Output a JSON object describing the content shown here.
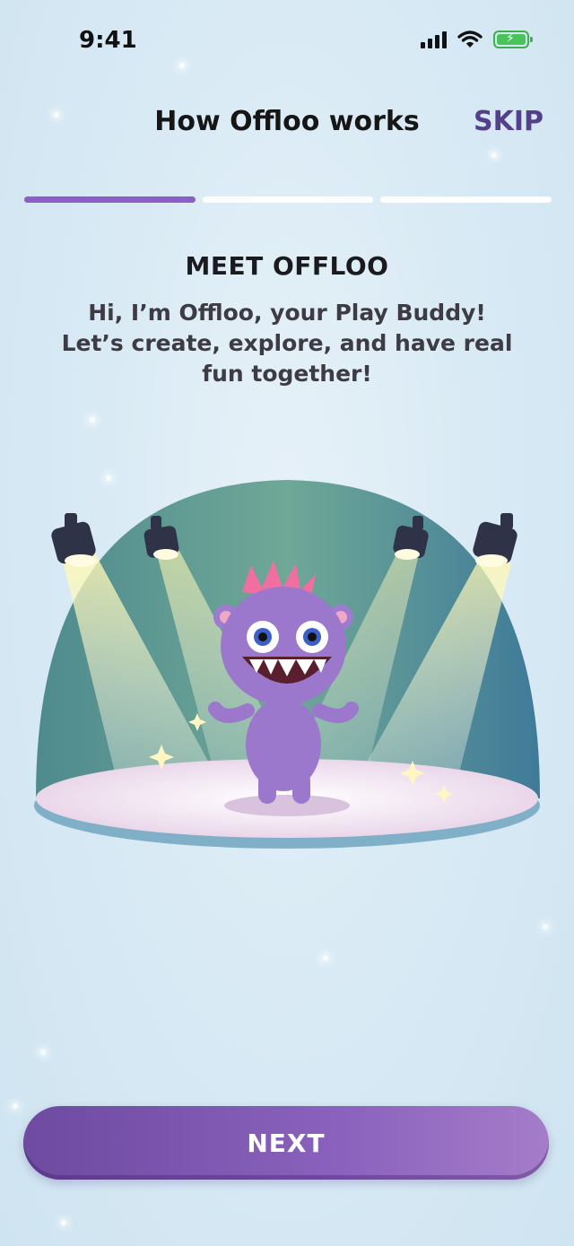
{
  "status_bar": {
    "time": "9:41",
    "icons": [
      "signal-icon",
      "wifi-icon",
      "battery-charging-icon"
    ]
  },
  "header": {
    "title": "How Offloo works",
    "skip_label": "SKIP"
  },
  "progress": {
    "total_steps": 3,
    "current_step": 1
  },
  "content": {
    "heading": "MEET OFFLOO",
    "description": "Hi, I’m Offloo, your Play Buddy! Let’s create, explore, and have real fun together!"
  },
  "illustration": {
    "subject": "purple-monster-on-stage-with-spotlights"
  },
  "footer": {
    "next_label": "NEXT"
  },
  "colors": {
    "accent": "#8b5fc7",
    "skip": "#54408a",
    "button_start": "#6e4aa0",
    "button_end": "#a57cc9"
  }
}
